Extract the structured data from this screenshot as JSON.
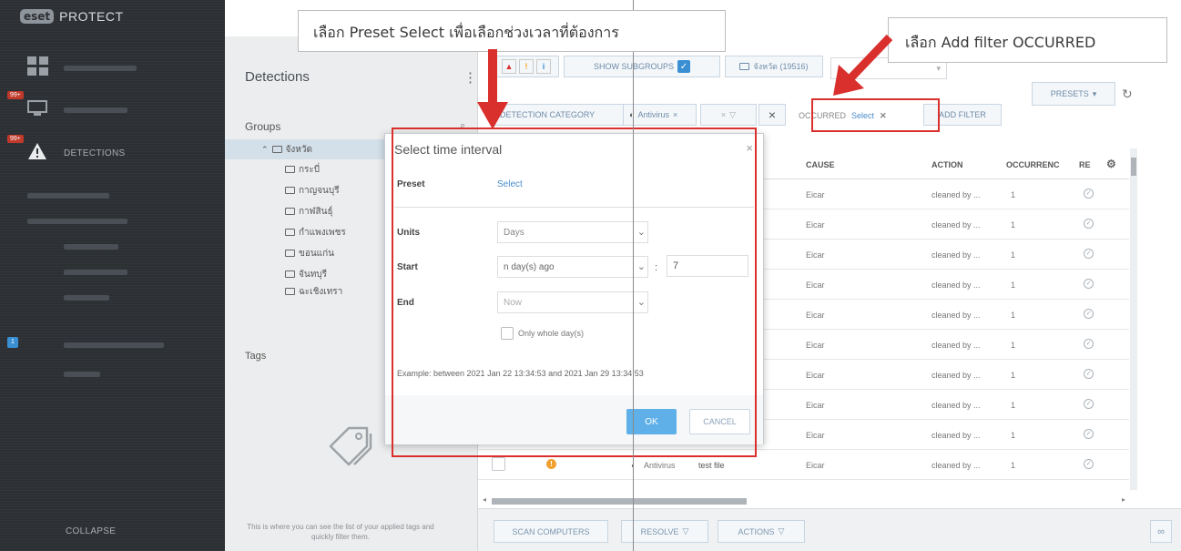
{
  "app": {
    "brand_badge": "eset",
    "brand_name": "PROTECT"
  },
  "nav": {
    "badge_1": "99+",
    "badge_2": "99+",
    "detections_label": "DETECTIONS",
    "blue_badge": "1",
    "collapse_label": "COLLAPSE"
  },
  "panel": {
    "title": "Detections",
    "menu": "⋮",
    "groups_title": "Groups",
    "groups": [
      {
        "label": "จังหวัด",
        "selected": true
      },
      {
        "label": "กระบี่"
      },
      {
        "label": "กาญจนบุรี"
      },
      {
        "label": "กาฬสินธุ์"
      },
      {
        "label": "กำแพงเพชร"
      },
      {
        "label": "ขอนแก่น"
      },
      {
        "label": "จันทบุรี"
      },
      {
        "label": "ฉะเชิงเทรา"
      }
    ],
    "tags_title": "Tags",
    "tags_note": "This is where you can see the list of your applied tags and quickly filter them."
  },
  "toolbar": {
    "show_subgroups": "SHOW SUBGROUPS",
    "group_filter": "จังหวัด (19516)",
    "detection_category": "DETECTION CATEGORY",
    "antivirus_chip": "Antivirus",
    "occurred_label": "OCCURRED",
    "occurred_value": "Select",
    "add_filter": "ADD FILTER",
    "presets": "PRESETS"
  },
  "table": {
    "columns": [
      "CAUSE",
      "ACTION",
      "OCCURRENC",
      "RE"
    ],
    "rows": [
      {
        "cause": "Eicar",
        "action": "cleaned by ...",
        "occurrences": "1"
      },
      {
        "cause": "Eicar",
        "action": "cleaned by ...",
        "occurrences": "1"
      },
      {
        "cause": "Eicar",
        "action": "cleaned by ...",
        "occurrences": "1"
      },
      {
        "cause": "Eicar",
        "action": "cleaned by ...",
        "occurrences": "1"
      },
      {
        "cause": "Eicar",
        "action": "cleaned by ...",
        "occurrences": "1"
      },
      {
        "cause": "Eicar",
        "action": "cleaned by ...",
        "occurrences": "1"
      },
      {
        "cause": "Eicar",
        "action": "cleaned by ...",
        "occurrences": "1"
      },
      {
        "cause": "Eicar",
        "action": "cleaned by ...",
        "occurrences": "1"
      },
      {
        "cause": "Eicar",
        "action": "cleaned by ...",
        "occurrences": "1"
      },
      {
        "cause": "Eicar",
        "action": "cleaned by ...",
        "occurrences": "1",
        "category": "Antivirus",
        "name": "test file"
      }
    ]
  },
  "bottom": {
    "scan_computers": "SCAN COMPUTERS",
    "resolve": "RESOLVE",
    "actions": "ACTIONS"
  },
  "dialog": {
    "title": "Select time interval",
    "close": "×",
    "preset_label": "Preset",
    "preset_value": "Select",
    "units_label": "Units",
    "units_value": "Days",
    "start_label": "Start",
    "start_value": "n day(s) ago",
    "start_number": "7",
    "end_label": "End",
    "end_value": "Now",
    "whole_days_label": "Only whole day(s)",
    "example": "Example: between 2021 Jan 22 13:34:53 and 2021 Jan 29 13:34:53",
    "ok": "OK",
    "cancel": "CANCEL"
  },
  "annotations": {
    "callout_preset": "เลือก Preset Select เพื่อเลือกช่วงเวลาที่ต้องการ",
    "callout_filter": "เลือก Add filter OCCURRED"
  },
  "colors": {
    "accent": "#3a8fd3",
    "annotation_red": "#d9302d",
    "nav_bg": "#2c2f33"
  }
}
